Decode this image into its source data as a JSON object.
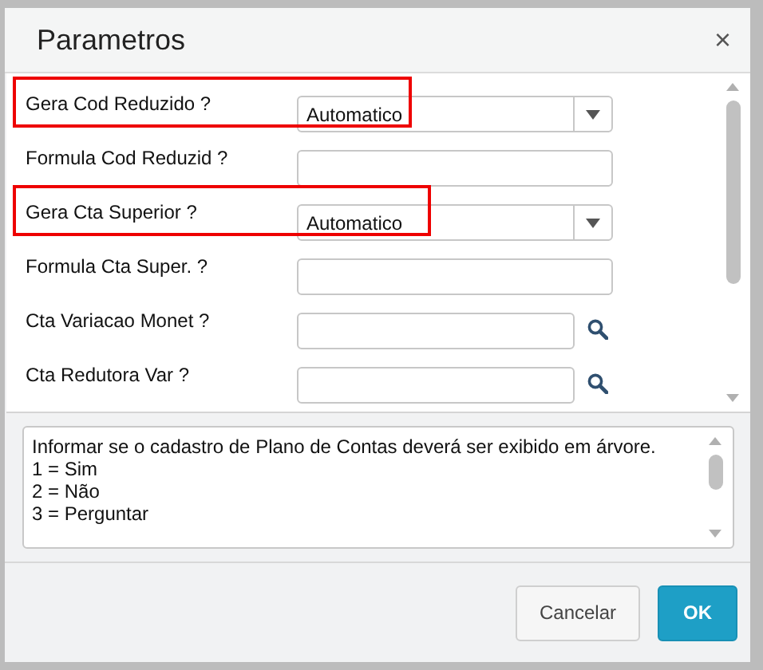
{
  "dialog": {
    "title": "Parametros",
    "close": "×"
  },
  "parameters": [
    {
      "kind": "select",
      "label": "Gera Cod Reduzido ?",
      "value": "Automatico",
      "highlighted": true
    },
    {
      "kind": "text",
      "label": "Formula Cod Reduzid ?",
      "highlighted": false
    },
    {
      "kind": "select",
      "label": "Gera Cta Superior ?",
      "value": "Automatico",
      "highlighted": true
    },
    {
      "kind": "text",
      "label": "Formula Cta Super. ?",
      "highlighted": false
    },
    {
      "kind": "lookup",
      "label": "Cta Variacao Monet ?",
      "highlighted": false
    },
    {
      "kind": "lookup",
      "label": "Cta Redutora Var ?",
      "highlighted": false
    }
  ],
  "help": [
    "Informar se o cadastro de Plano de Contas deverá ser exibido em árvore.",
    "1 = Sim",
    "2 = Não",
    "3 = Perguntar"
  ],
  "buttons": [
    {
      "kind": "secondary",
      "label": "Cancelar"
    },
    {
      "kind": "primary",
      "label": "OK"
    }
  ]
}
